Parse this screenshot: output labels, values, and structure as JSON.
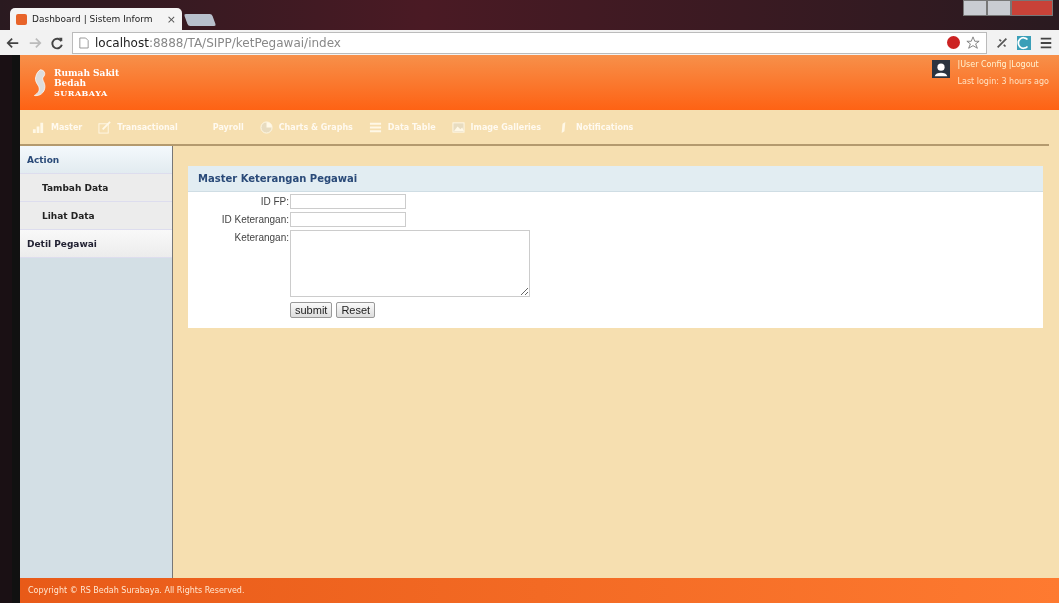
{
  "browser": {
    "tab_title": "Dashboard | Sistem Inform",
    "tab_close": "×",
    "url_host": "localhost",
    "url_path": ":8888/TA/SIPP/ketPegawai/index"
  },
  "header": {
    "logo_lines": [
      "Rumah Sakit",
      "Bedah",
      "SURABAYA"
    ],
    "user_links": [
      "|User Config",
      "|Logout"
    ],
    "last_login": "Last login: 3 hours ago"
  },
  "nav": [
    {
      "label": "Master",
      "kind": "bars"
    },
    {
      "label": "Transactional",
      "kind": "edit"
    },
    {
      "label": "Payroll",
      "kind": "plain"
    },
    {
      "label": "Charts & Graphs",
      "kind": "chart"
    },
    {
      "label": "Data Table",
      "kind": "table"
    },
    {
      "label": "Image Galleries",
      "kind": "image"
    },
    {
      "label": "Notifications",
      "kind": "pen"
    }
  ],
  "sidebar": [
    {
      "label": "Action",
      "kind": "heading"
    },
    {
      "label": "Tambah Data",
      "kind": "sub"
    },
    {
      "label": "Lihat Data",
      "kind": "sub"
    },
    {
      "label": "Detil Pegawai",
      "kind": "heading"
    }
  ],
  "form": {
    "title": "Master Keterangan Pegawai",
    "fields": [
      {
        "label": "ID FP:",
        "kind": "input"
      },
      {
        "label": "ID Keterangan:",
        "kind": "input"
      },
      {
        "label": "Keterangan:",
        "kind": "textarea"
      }
    ],
    "buttons": [
      "submit",
      "Reset"
    ]
  },
  "footer": "Copyright © RS Bedah Surabaya. All Rights Reserved."
}
